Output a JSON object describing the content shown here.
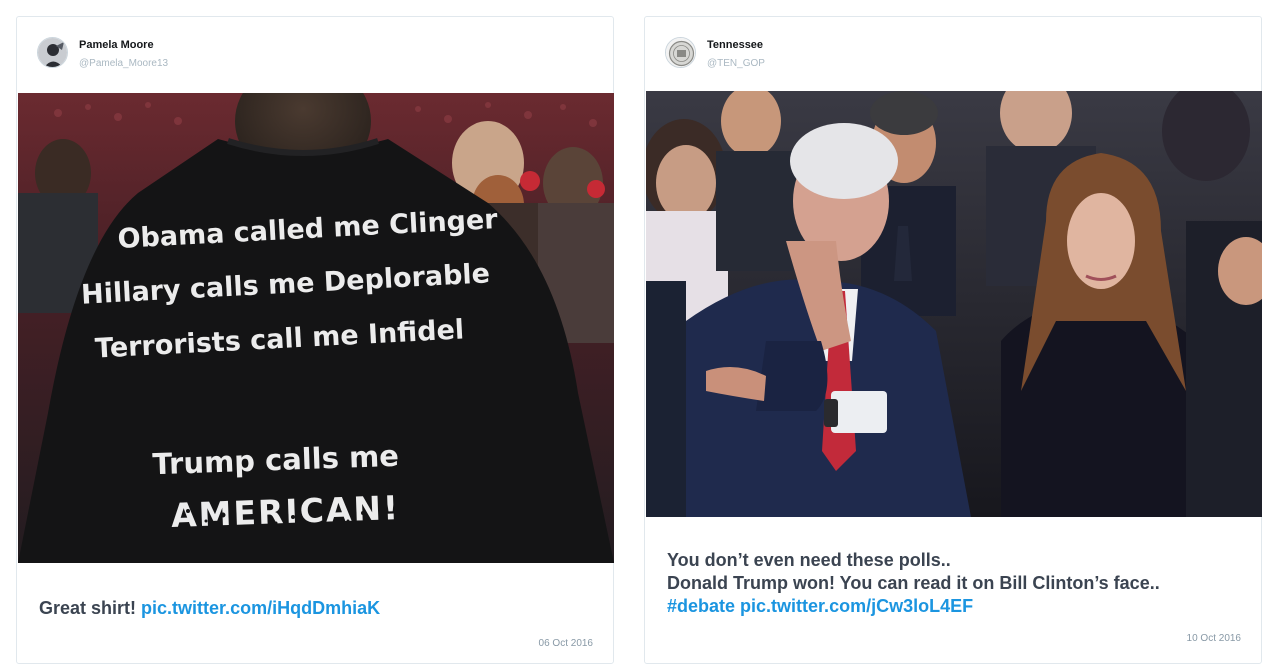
{
  "tweets": [
    {
      "author": {
        "name": "Pamela Moore",
        "handle": "@Pamela_Moore13"
      },
      "photo": {
        "shirt_lines": [
          "Obama called me Clinger",
          "Hillary calls me Deplorable",
          "Terrorists call me Infidel",
          "Trump calls me",
          "AMERICAN!"
        ]
      },
      "text": "Great shirt!",
      "link": "pic.twitter.com/iHqdDmhiaK",
      "date": "06 Oct 2016"
    },
    {
      "author": {
        "name": "Tennessee",
        "handle": "@TEN_GOP"
      },
      "text_line1": "You don’t even need these polls..",
      "text_line2": "Donald Trump won! You can read it on Bill Clinton’s face..",
      "hashtag": "#debate",
      "link": "pic.twitter.com/jCw3loL4EF",
      "date": "10 Oct 2016"
    }
  ]
}
